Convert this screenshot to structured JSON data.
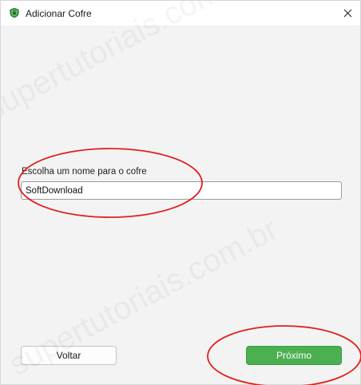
{
  "window": {
    "title": "Adicionar Cofre"
  },
  "form": {
    "label": "Escolha um nome para o cofre",
    "value": "SoftDownload"
  },
  "buttons": {
    "back_label": "Voltar",
    "next_label": "Próximo"
  },
  "watermark": {
    "text": "supertutoriais.com.br"
  },
  "colors": {
    "primary_button": "#4caf50",
    "annotation": "#e0201c",
    "content_background": "#f3f3f3"
  },
  "icons": {
    "app": "shield-lock-icon",
    "close": "close-icon"
  }
}
